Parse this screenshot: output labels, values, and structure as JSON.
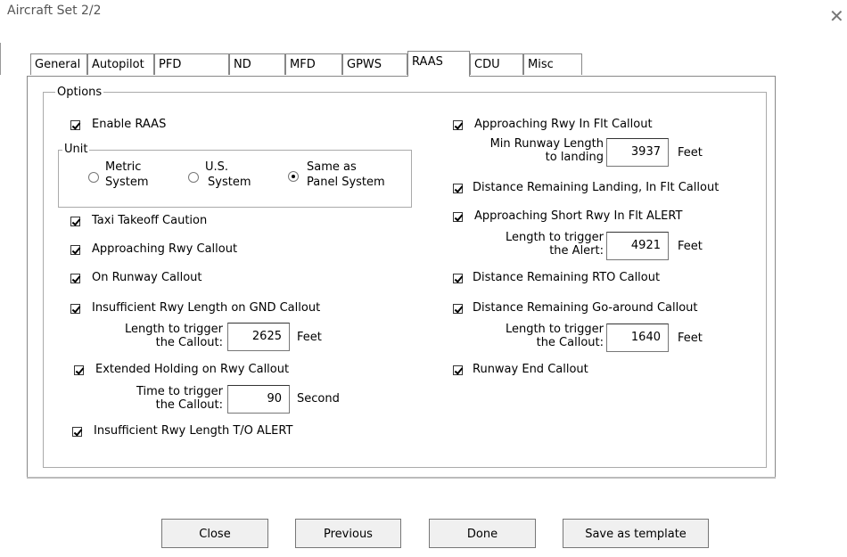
{
  "window": {
    "title": "Aircraft Set 2/2",
    "close_glyph": "✕"
  },
  "tabs": [
    {
      "label": "General",
      "active": false
    },
    {
      "label": "Autopilot",
      "active": false
    },
    {
      "label": "PFD",
      "active": false
    },
    {
      "label": "ND",
      "active": false
    },
    {
      "label": "MFD",
      "active": false
    },
    {
      "label": "GPWS",
      "active": false
    },
    {
      "label": "RAAS",
      "active": true
    },
    {
      "label": "CDU",
      "active": false
    },
    {
      "label": "Misc",
      "active": false
    }
  ],
  "options": {
    "group_label": "Options",
    "enable_raas": {
      "label": "Enable RAAS",
      "checked": true
    },
    "unit": {
      "group_label": "Unit",
      "metric": {
        "line1": "Metric",
        "line2": "System",
        "selected": false
      },
      "us": {
        "line1": "U.S.",
        "line2": "System",
        "selected": false
      },
      "panel": {
        "line1": "Same as",
        "line2": "Panel System",
        "selected": true
      }
    },
    "left": {
      "taxi_takeoff": {
        "label": "Taxi Takeoff Caution",
        "checked": true
      },
      "approaching_rwy": {
        "label": "Approaching Rwy Callout",
        "checked": true
      },
      "on_runway": {
        "label": "On Runway Callout",
        "checked": true
      },
      "insufficient_gnd": {
        "label": "Insufficient Rwy Length on GND Callout",
        "checked": true
      },
      "insufficient_gnd_trigger": {
        "line1": "Length to trigger",
        "line2": "the Callout:",
        "value": "2625",
        "unit": "Feet"
      },
      "extended_holding": {
        "label": "Extended Holding on Rwy Callout",
        "checked": true
      },
      "extended_holding_trigger": {
        "line1": "Time to trigger",
        "line2": "the Callout:",
        "value": "90",
        "unit": "Second"
      },
      "insufficient_to": {
        "label": "Insufficient Rwy Length T/O ALERT",
        "checked": true
      }
    },
    "right": {
      "approaching_flt": {
        "label": "Approaching Rwy In Flt Callout",
        "checked": true
      },
      "min_runway": {
        "line1": "Min Runway Length",
        "line2": "to landing",
        "value": "3937",
        "unit": "Feet"
      },
      "dist_landing": {
        "label": "Distance Remaining Landing, In Flt Callout",
        "checked": true
      },
      "short_rwy": {
        "label": "Approaching Short Rwy In Flt ALERT",
        "checked": true
      },
      "short_rwy_trigger": {
        "line1": "Length to trigger",
        "line2": "the Alert:",
        "value": "4921",
        "unit": "Feet"
      },
      "dist_rto": {
        "label": "Distance Remaining RTO Callout",
        "checked": true
      },
      "dist_goaround": {
        "label": "Distance Remaining Go-around Callout",
        "checked": true
      },
      "goaround_trigger": {
        "line1": "Length to trigger",
        "line2": "the Callout:",
        "value": "1640",
        "unit": "Feet"
      },
      "runway_end": {
        "label": "Runway End Callout",
        "checked": true
      }
    }
  },
  "buttons": {
    "close": "Close",
    "previous": "Previous",
    "done": "Done",
    "save_template": "Save as template"
  }
}
